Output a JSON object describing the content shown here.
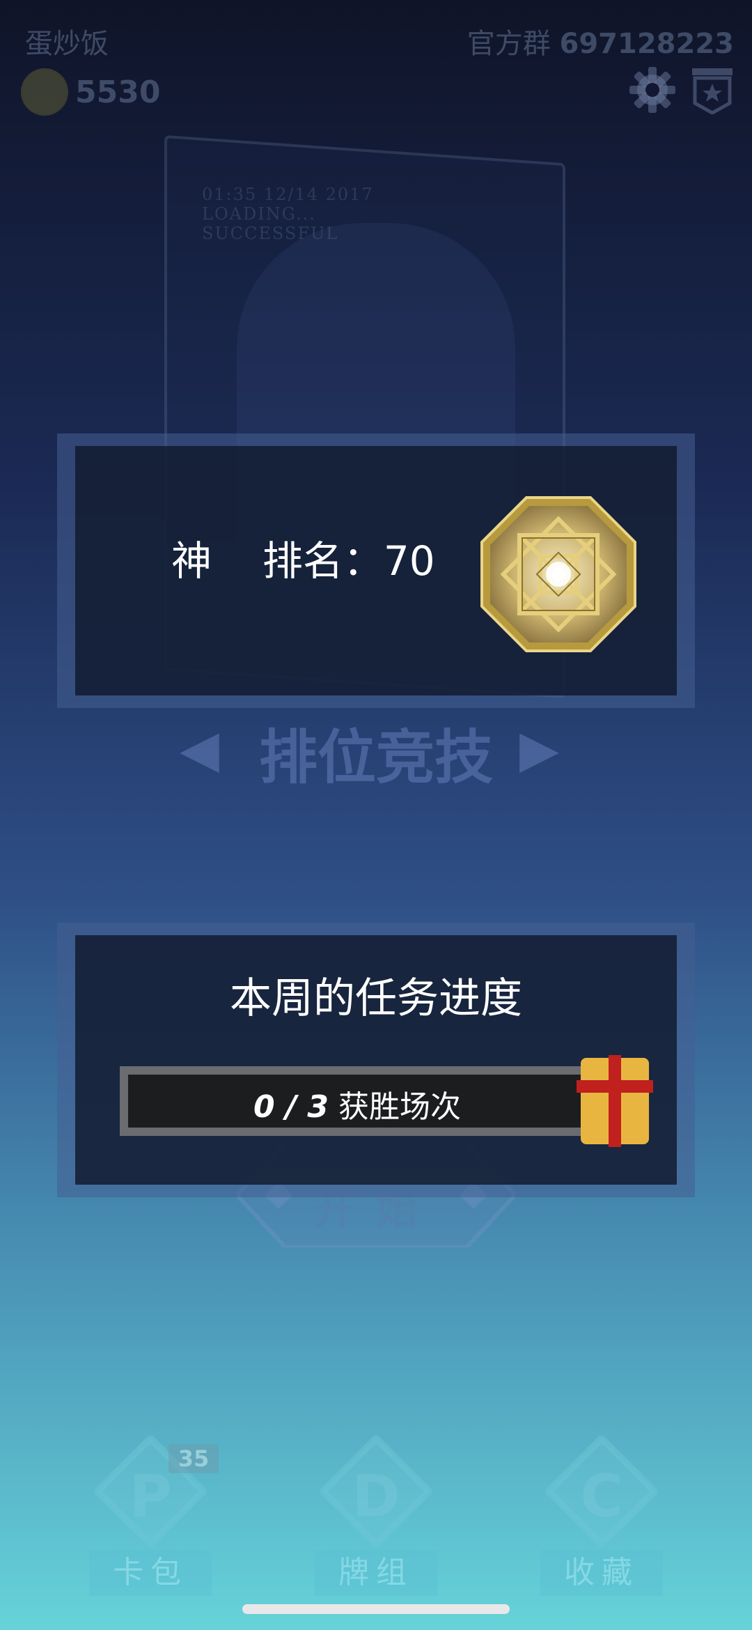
{
  "header": {
    "player_name": "蛋炒饭",
    "coins": "5530",
    "group_label": "官方群",
    "group_number": "697128223",
    "icons": [
      "coin-icon",
      "gear-icon",
      "rank-badge-icon"
    ]
  },
  "background": {
    "card_text": [
      "01:35  12/14 2017",
      "LOADING...",
      "SUCCESSFUL"
    ],
    "mode_title": "排位竞技",
    "mode_prev": "◀",
    "mode_next": "▶",
    "start_label": "开始"
  },
  "rank_panel": {
    "tier": "神",
    "rank_label": "排名：",
    "rank_value": "70",
    "emblem_icon": "octagon-rank-emblem-icon"
  },
  "task_panel": {
    "title": "本周的任务进度",
    "progress_count": "0 / 3",
    "progress_label": "获胜场次",
    "progress_fraction": 0,
    "gift_icon": "gift-box-icon"
  },
  "bottom_nav": {
    "items": [
      {
        "letter": "P",
        "label": "卡包",
        "badge": "35"
      },
      {
        "letter": "D",
        "label": "牌组"
      },
      {
        "letter": "C",
        "label": "收藏"
      }
    ]
  },
  "colors": {
    "panel_bg": "#10182c",
    "progress_frame": "#6a6c70",
    "emblem_gold": "#d8c27a",
    "gift_yellow": "#e8b640",
    "gift_ribbon": "#c0201e"
  }
}
